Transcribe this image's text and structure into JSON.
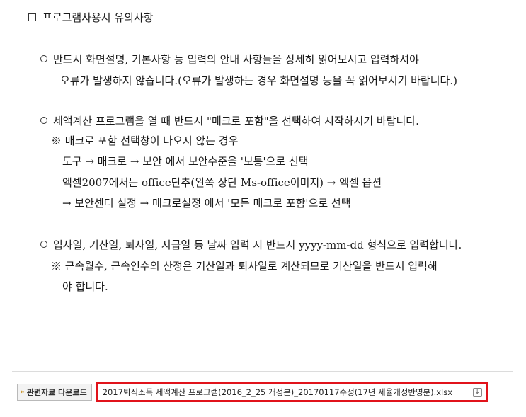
{
  "title": "프로그램사용시 유의사항",
  "sections": [
    {
      "lines": [
        "반드시 화면설명, 기본사항 등 입력의 안내 사항들을 상세히 읽어보시고 입력하셔야",
        "오류가 발생하지 않습니다.(오류가 발생하는 경우 화면설명 등을 꼭 읽어보시기 바랍니다.)"
      ]
    },
    {
      "lines": [
        "세액계산 프로그램을 열 때 반드시 \"매크로 포함\"을 선택하여 시작하시기 바랍니다.",
        "※ 매크로 포함 선택창이 나오지 않는 경우",
        "도구 → 매크로 → 보안 에서 보안수준을 '보통'으로 선택",
        "엑셀2007에서는 office단추(왼쪽 상단 Ms-office이미지) → 엑셀 옵션",
        "→ 보안센터 설정 → 매크로설정 에서 '모든 매크로 포함'으로 선택"
      ]
    },
    {
      "lines": [
        "입사일, 기산일, 퇴사일, 지급일 등 날짜 입력 시 반드시 yyyy-mm-dd 형식으로 입력합니다.",
        "※ 근속월수, 근속연수의 산정은 기산일과 퇴사일로 계산되므로 기산일을 반드시 입력해",
        "야 합니다."
      ]
    }
  ],
  "download": {
    "label": "관련자료 다운로드",
    "file_name": "2017퇴직소득 세액계산 프로그램(2016_2_25 개정분)_20170117수정(17년 세율개정반영분).xlsx",
    "icon": "download-icon",
    "highlight_color": "#e1131b"
  }
}
